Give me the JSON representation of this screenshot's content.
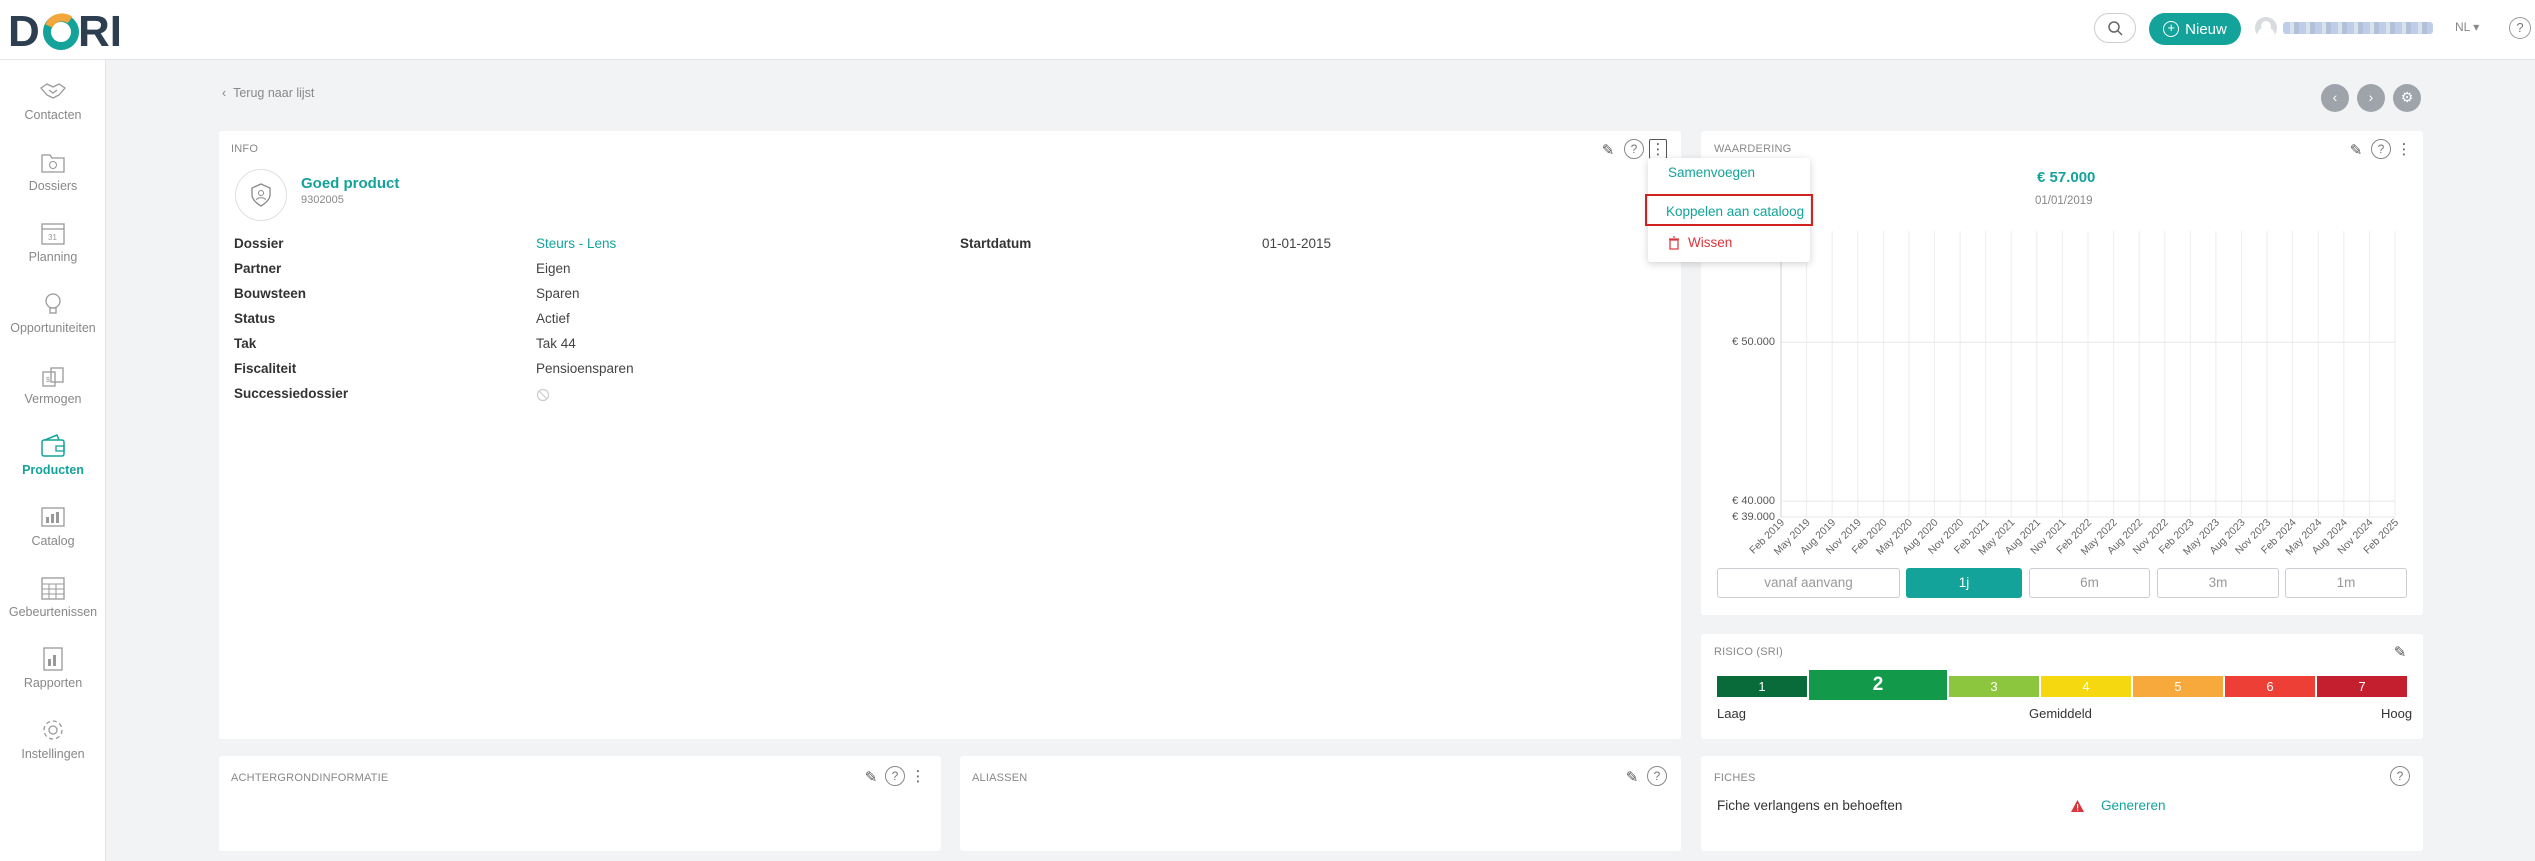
{
  "brand": {
    "logo_text": "D RI",
    "accent": "#13a39a"
  },
  "header": {
    "new_button_label": "Nieuw",
    "language": "NL",
    "help_symbol": "?"
  },
  "sidebar": {
    "items": [
      {
        "label": "Contacten",
        "icon": "handshake-icon"
      },
      {
        "label": "Dossiers",
        "icon": "folder-icon"
      },
      {
        "label": "Planning",
        "icon": "calendar-icon"
      },
      {
        "label": "Opportuniteiten",
        "icon": "lightbulb-icon"
      },
      {
        "label": "Vermogen",
        "icon": "money-icon"
      },
      {
        "label": "Producten",
        "icon": "wallet-icon"
      },
      {
        "label": "Catalog",
        "icon": "chart-icon"
      },
      {
        "label": "Gebeurtenissen",
        "icon": "grid-calendar-icon"
      },
      {
        "label": "Rapporten",
        "icon": "report-icon"
      },
      {
        "label": "Instellingen",
        "icon": "gear-icon"
      }
    ]
  },
  "back_link": "Terug naar lijst",
  "info": {
    "title": "INFO",
    "product_name": "Goed product",
    "product_code": "9302005",
    "fields_left": [
      {
        "label": "Dossier",
        "value": "Steurs - Lens"
      },
      {
        "label": "Partner",
        "value": "Eigen"
      },
      {
        "label": "Bouwsteen",
        "value": "Sparen"
      },
      {
        "label": "Status",
        "value": "Actief"
      },
      {
        "label": "Tak",
        "value": "Tak 44"
      },
      {
        "label": "Fiscaliteit",
        "value": "Pensioensparen"
      },
      {
        "label": "Successiedossier",
        "value": ""
      }
    ],
    "fields_right": [
      {
        "label": "Startdatum",
        "value": "01-01-2015"
      }
    ]
  },
  "menu": {
    "merge": "Samenvoegen",
    "link_catalog": "Koppelen aan cataloog",
    "delete": "Wissen"
  },
  "valuation": {
    "title": "WAARDERING",
    "amount": "€ 57.000",
    "date": "01/01/2019",
    "periods": [
      {
        "label": "vanaf aanvang",
        "active": false
      },
      {
        "label": "1j",
        "active": true
      },
      {
        "label": "6m",
        "active": false
      },
      {
        "label": "3m",
        "active": false
      },
      {
        "label": "1m",
        "active": false
      }
    ]
  },
  "chart_data": {
    "type": "line",
    "x": [
      "Feb 2019",
      "May 2019",
      "Aug 2019",
      "Nov 2019",
      "Feb 2020",
      "May 2020",
      "Aug 2020",
      "Nov 2020",
      "Feb 2021",
      "May 2021",
      "Aug 2021",
      "Nov 2021",
      "Feb 2022",
      "May 2022",
      "Aug 2022",
      "Nov 2022",
      "Feb 2023",
      "May 2023",
      "Aug 2023",
      "Nov 2023",
      "Feb 2024",
      "May 2024",
      "Aug 2024",
      "Nov 2024",
      "Feb 2025"
    ],
    "y_ticks": [
      "€ 50.000",
      "€ 40.000",
      "€ 39.000"
    ],
    "y_tick_values": [
      50000,
      40000,
      39000
    ],
    "ylim": [
      39000,
      57000
    ],
    "grid": true,
    "series": []
  },
  "risk": {
    "title": "RISICO (SRI)",
    "levels": [
      {
        "label": "1",
        "color": "#0a6b3a"
      },
      {
        "label": "2",
        "color": "#12994a"
      },
      {
        "label": "3",
        "color": "#8cc63f"
      },
      {
        "label": "4",
        "color": "#f5d80f"
      },
      {
        "label": "5",
        "color": "#f7a93b"
      },
      {
        "label": "6",
        "color": "#ee3f37"
      },
      {
        "label": "7",
        "color": "#c41f2e"
      }
    ],
    "selected": 2,
    "low": "Laag",
    "mid": "Gemiddeld",
    "high": "Hoog"
  },
  "background": {
    "title": "ACHTERGRONDINFORMATIE"
  },
  "aliases": {
    "title": "ALIASSEN"
  },
  "fiches": {
    "title": "FICHES",
    "row_label": "Fiche verlangens en behoeften",
    "action": "Genereren"
  }
}
